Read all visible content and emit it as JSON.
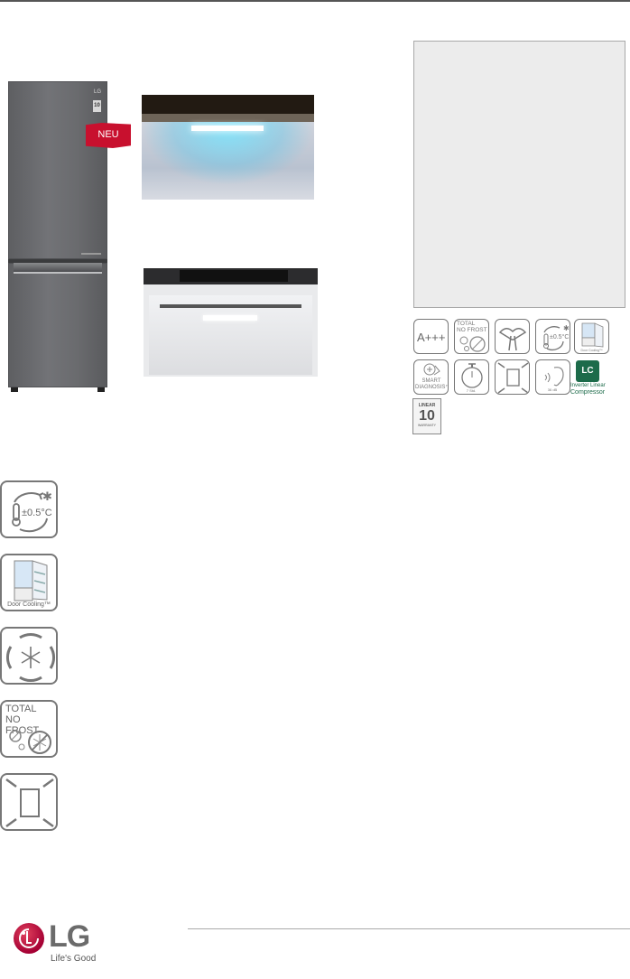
{
  "document": {
    "brand": "LG",
    "tagline": "Life's Good",
    "badge_new": "NEU",
    "fridge_badge": "10"
  },
  "colors": {
    "brand_red": "#A50034",
    "badge_red": "#C8102E",
    "icon_gray": "#777777",
    "lc_green": "#1D6B4A",
    "placeholder_gray": "#ECECEC"
  },
  "images": [
    {
      "name": "product-fridge",
      "alt": "Bottom-freezer fridge, graphite"
    },
    {
      "name": "door-cooling-airflow-photo",
      "alt": "Interior air flow"
    },
    {
      "name": "fridge-interior-display-photo",
      "alt": "Interior with display"
    }
  ],
  "feature_icons": [
    {
      "name": "energy-class-icon",
      "text": "A+++"
    },
    {
      "name": "total-no-frost-icon",
      "text": "TOTAL\nNO FROST",
      "line1": "TOTAL",
      "line2": "NO FROST"
    },
    {
      "name": "fresh-lips-icon",
      "text": ""
    },
    {
      "name": "fresh-balancer-temp-icon",
      "text": "±0.5°C"
    },
    {
      "name": "door-cooling-icon",
      "text": "Door Cooling™"
    },
    {
      "name": "smart-diagnosis-icon",
      "line1": "SMART",
      "line2": "DIAGNOSIS™"
    },
    {
      "name": "timer-icon",
      "text": "7 Std."
    },
    {
      "name": "capacity-expand-icon",
      "text": ""
    },
    {
      "name": "low-noise-icon",
      "text": "36 dB"
    },
    {
      "name": "linear-compressor-icon",
      "text": "LC",
      "line1": "Inverter Linear",
      "line2": "Compressor"
    },
    {
      "name": "warranty-10-year-icon",
      "line1": "LINEAR",
      "number": "10",
      "line2": "WARRANTY"
    }
  ],
  "feature_list": [
    {
      "name": "fresh-balancer-temp-icon",
      "text": "±0.5°C"
    },
    {
      "name": "door-cooling-icon",
      "text": "Door Cooling™"
    },
    {
      "name": "multi-airflow-icon",
      "text": ""
    },
    {
      "name": "total-no-frost-icon",
      "line1": "TOTAL",
      "line2": "NO FROST"
    },
    {
      "name": "capacity-expand-icon",
      "text": ""
    }
  ]
}
